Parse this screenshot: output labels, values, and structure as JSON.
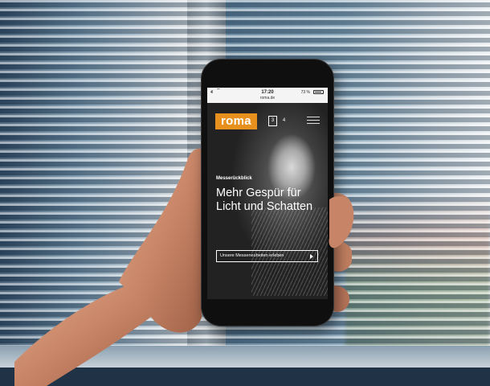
{
  "status_bar": {
    "signal": "•ll",
    "wifi": "⌔",
    "time": "17:20",
    "url": "roma.de",
    "battery_text": "73 %"
  },
  "site": {
    "logo": "roma",
    "language_options": [
      "3",
      "4"
    ],
    "eyebrow": "Messerückblick",
    "headline": "Mehr Gespür für Licht und Schatten",
    "cta_label": "Unsere Messeneuheiten erleben"
  },
  "icons": {
    "menu": "hamburger-menu-icon",
    "cta_arrow": "play-arrow-icon"
  },
  "colors": {
    "brand": "#e8901d",
    "text_on_hero": "#ffffff"
  }
}
